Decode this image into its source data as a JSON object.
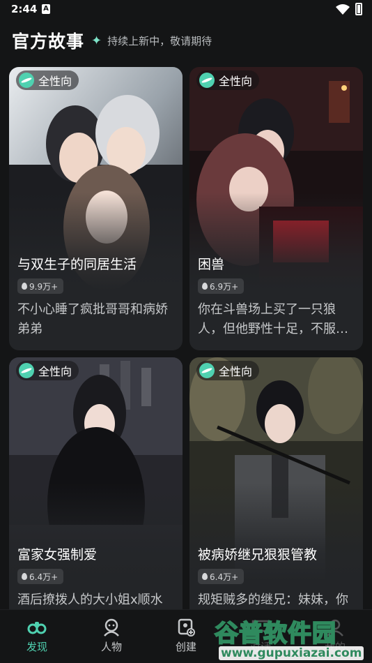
{
  "status_bar": {
    "time": "2:44",
    "notification_icon": "A"
  },
  "header": {
    "title": "官方故事",
    "subtitle": "持续上新中，敬请期待"
  },
  "cards": [
    {
      "tag": "全性向",
      "name": "与双生子的同居生活",
      "heat": "9.9万+",
      "desc": "不小心睡了疯批哥哥和病娇弟弟"
    },
    {
      "tag": "全性向",
      "name": "困兽",
      "heat": "6.9万+",
      "desc": "你在斗兽场上买了一只狼人，但他野性十足，不服…"
    },
    {
      "tag": "全性向",
      "name": "富家女强制爱",
      "heat": "6.4万+",
      "desc": "酒后撩拨人的大小姐x顺水"
    },
    {
      "tag": "全性向",
      "name": "被病娇继兄狠狠管教",
      "heat": "6.4万+",
      "desc": "规矩贼多的继兄：妹妹，你"
    }
  ],
  "tabbar": {
    "items": [
      {
        "label": "发现",
        "icon": "binoculars-icon",
        "active": true
      },
      {
        "label": "人物",
        "icon": "character-icon",
        "active": false
      },
      {
        "label": "创建",
        "icon": "create-icon",
        "active": false
      },
      {
        "label": "对话",
        "icon": "chat-icon",
        "active": false
      },
      {
        "label": "我的",
        "icon": "profile-icon",
        "active": false
      }
    ]
  },
  "watermark": {
    "text": "谷普软件园",
    "url": "www.gupuxiazai.com"
  },
  "colors": {
    "accent": "#4fd1b0",
    "background": "#141516",
    "card": "#232528"
  }
}
